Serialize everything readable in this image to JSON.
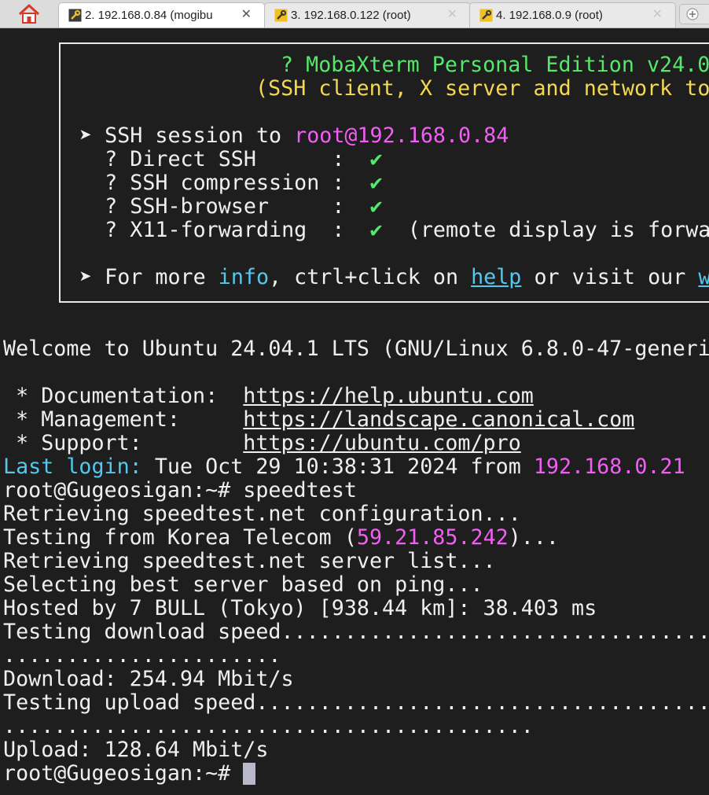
{
  "tabs": [
    {
      "label": "2. 192.168.0.84 (mogibu",
      "active": true
    },
    {
      "label": "3. 192.168.0.122 (root)",
      "active": false
    },
    {
      "label": "4. 192.168.0.9 (root)",
      "active": false
    }
  ],
  "tab_close_glyph": "✕",
  "icons": {
    "home": "home-icon",
    "tab": "tool-icon",
    "new_tab": "new-tab-icon"
  },
  "colors": {
    "green": "#55e86a",
    "yellow": "#f5d84f",
    "magenta": "#f25ef5",
    "cyan": "#53c8ef",
    "text": "#efefef",
    "background": "#1e1e1e"
  },
  "banner": {
    "title": "? MobaXterm Personal Edition v24.0",
    "subtitle": "(SSH client, X server and network to",
    "session_prefix": "➤ SSH session to ",
    "session_target": "root@192.168.0.84",
    "features": [
      {
        "label": "  ? Direct SSH      :  ",
        "check": "✔",
        "note": ""
      },
      {
        "label": "  ? SSH compression :  ",
        "check": "✔",
        "note": ""
      },
      {
        "label": "  ? SSH-browser     :  ",
        "check": "✔",
        "note": ""
      },
      {
        "label": "  ? X11-forwarding  :  ",
        "check": "✔",
        "note": "  (remote display is forwa"
      }
    ],
    "info_prefix": "➤ For more ",
    "info_word": "info",
    "info_mid": ", ctrl+click on ",
    "help_word": "help",
    "info_tail": " or visit our ",
    "website_fragment": "we"
  },
  "terminal": {
    "welcome": "Welcome to Ubuntu 24.04.1 LTS (GNU/Linux 6.8.0-47-generi",
    "links": [
      {
        "label": " * Documentation:  ",
        "url": "https://help.ubuntu.com"
      },
      {
        "label": " * Management:     ",
        "url": "https://landscape.canonical.com"
      },
      {
        "label": " * Support:        ",
        "url": "https://ubuntu.com/pro"
      }
    ],
    "last_login_label": "Last login:",
    "last_login_text": " Tue Oct 29 10:38:31 2024 from ",
    "last_login_ip": "192.168.0.21",
    "prompt": "root@Gugeosigan:~# ",
    "command": "speedtest",
    "retrieving_config": "Retrieving speedtest.net configuration...",
    "testing_from_prefix": "Testing from Korea Telecom (",
    "testing_from_ip": "59.21.85.242",
    "testing_from_suffix": ")...",
    "retrieving_servers": "Retrieving speedtest.net server list...",
    "selecting_server": "Selecting best server based on ping...",
    "hosted_by": "Hosted by 7 BULL (Tokyo) [938.44 km]: 38.403 ms",
    "testing_download": "Testing download speed................................................",
    "download_dots": "......................",
    "download_result": "Download: 254.94 Mbit/s",
    "testing_upload": "Testing upload speed..................................................",
    "upload_dots": "..........................................",
    "upload_result": "Upload: 128.64 Mbit/s",
    "final_prompt": "root@Gugeosigan:~# "
  }
}
